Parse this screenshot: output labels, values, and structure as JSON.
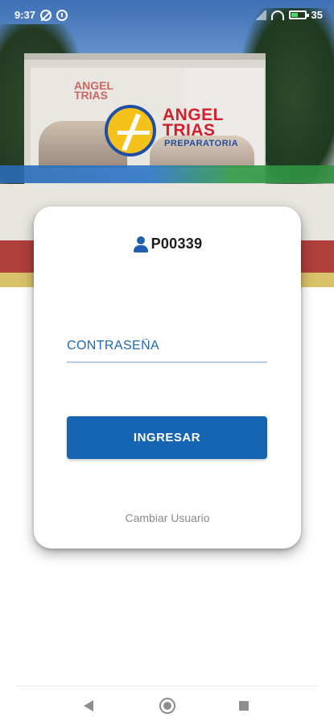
{
  "status_bar": {
    "time": "9:37",
    "battery_level": "35",
    "icons": [
      "data-saver-icon",
      "alarm-icon",
      "signal-icon",
      "wifi-icon",
      "battery-icon"
    ],
    "text_color": "#ffffff"
  },
  "header": {
    "logo_name_line1": "ANGEL",
    "logo_name_line2": "TRIAS",
    "logo_subtitle": "PREPARATORIA",
    "logo_colors": {
      "name": "#d21f2b",
      "subtitle": "#1f4ea3",
      "mark_fill": "#f4c21a",
      "mark_ring": "#1f4ea3"
    },
    "background_image": "photo-of-school-building"
  },
  "login_card": {
    "user_icon": "person-icon",
    "user_id": "P00339",
    "password_placeholder": "CONTRASEÑA",
    "submit_label": "INGRESAR",
    "change_user_label": "Cambiar Usuario",
    "accent_color": "#1565b3"
  },
  "nav_bar": {
    "icons": [
      "back-icon",
      "home-icon",
      "recents-icon"
    ]
  }
}
